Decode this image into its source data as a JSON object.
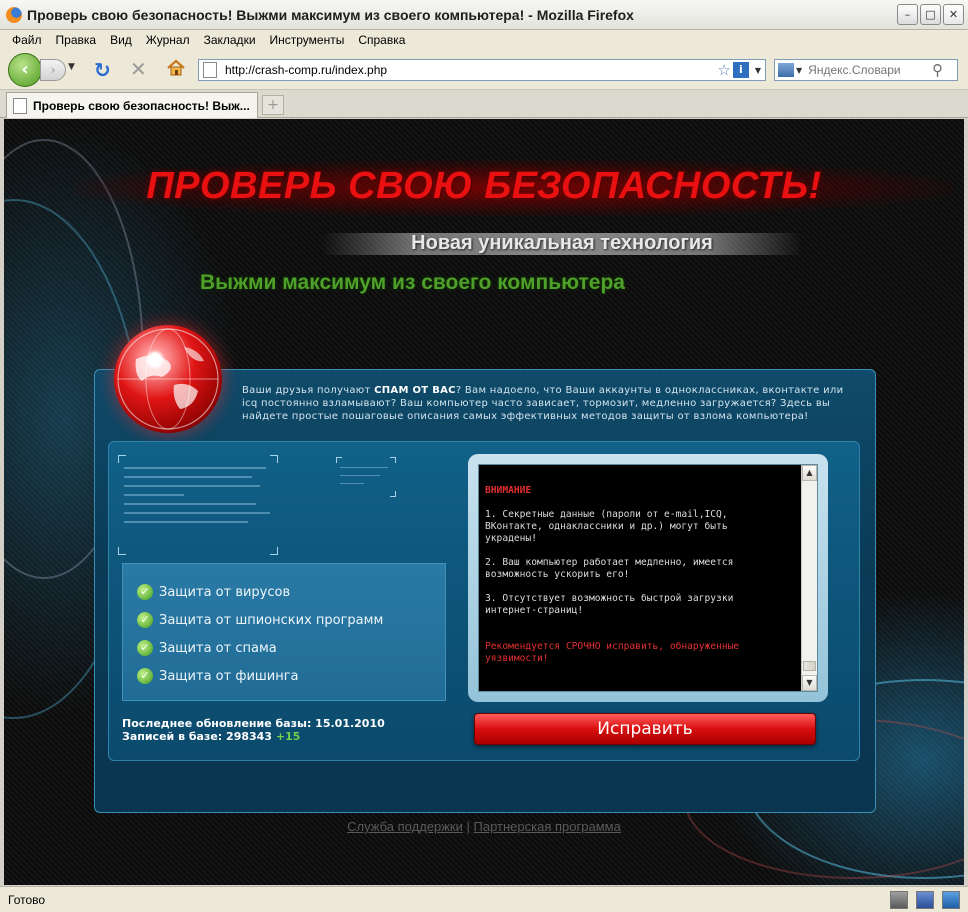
{
  "window": {
    "title": "Проверь свою безопасность! Выжми максимум из своего компьютера! - Mozilla Firefox",
    "minimize": "–",
    "maximize": "□",
    "close": "✕"
  },
  "menu": [
    "Файл",
    "Правка",
    "Вид",
    "Журнал",
    "Закладки",
    "Инструменты",
    "Справка"
  ],
  "nav": {
    "url": "http://crash-comp.ru/index.php",
    "search_placeholder": "Яндекс.Словари"
  },
  "tab": {
    "label": "Проверь свою безопасность! Выж...",
    "new_tab": "+"
  },
  "page": {
    "headline": "ПРОВЕРЬ СВОЮ БЕЗОПАСНОСТЬ!",
    "subheadline": "Новая уникальная технология",
    "tagline": "Выжми максимум из своего компьютера",
    "intro_before": "Ваши друзья получают ",
    "intro_strong": "СПАМ ОТ ВАС",
    "intro_after": "? Вам надоело, что Ваши аккаунты в одноклассниках, вконтакте или icq постоянно взламывают? Ваш компьютер часто зависает, тормозит, медленно загружается? Здесь вы найдете простые пошаговые описания самых эффективных методов защиты от взлома компьютера!",
    "protections": [
      "Защита от вирусов",
      "Защита от шпионских программ",
      "Защита от спама",
      "Защита от фишинга"
    ],
    "db_update": "Последнее обновление базы: 15.01.2010",
    "db_records_label": "Записей в базе: 298343",
    "db_records_delta": "+15",
    "screen": {
      "title": "ВНИМАНИЕ",
      "items": [
        "1. Секретные данные (пароли от e-mail,ICQ, ВКонтакте, однаклассники и др.) могут быть украдены!",
        "2. Ваш компьютер работает медленно, имеется возможность ускорить его!",
        "3. Отсутствует возможность быстрой загрузки интернет-страниц!"
      ],
      "recommendation": "Рекомендуется СРОЧНО исправить, обнаруженные уязвимости!"
    },
    "fix_button": "Исправить",
    "footer": {
      "support": "Служба поддержки",
      "separator": "|",
      "partner": "Партнерская программа"
    }
  },
  "status": {
    "text": "Готово"
  },
  "colors": {
    "headline_red": "#e81010",
    "tagline_green": "#4ea028",
    "panel_blue": "#0d5479",
    "warning_red": "#e23030"
  }
}
